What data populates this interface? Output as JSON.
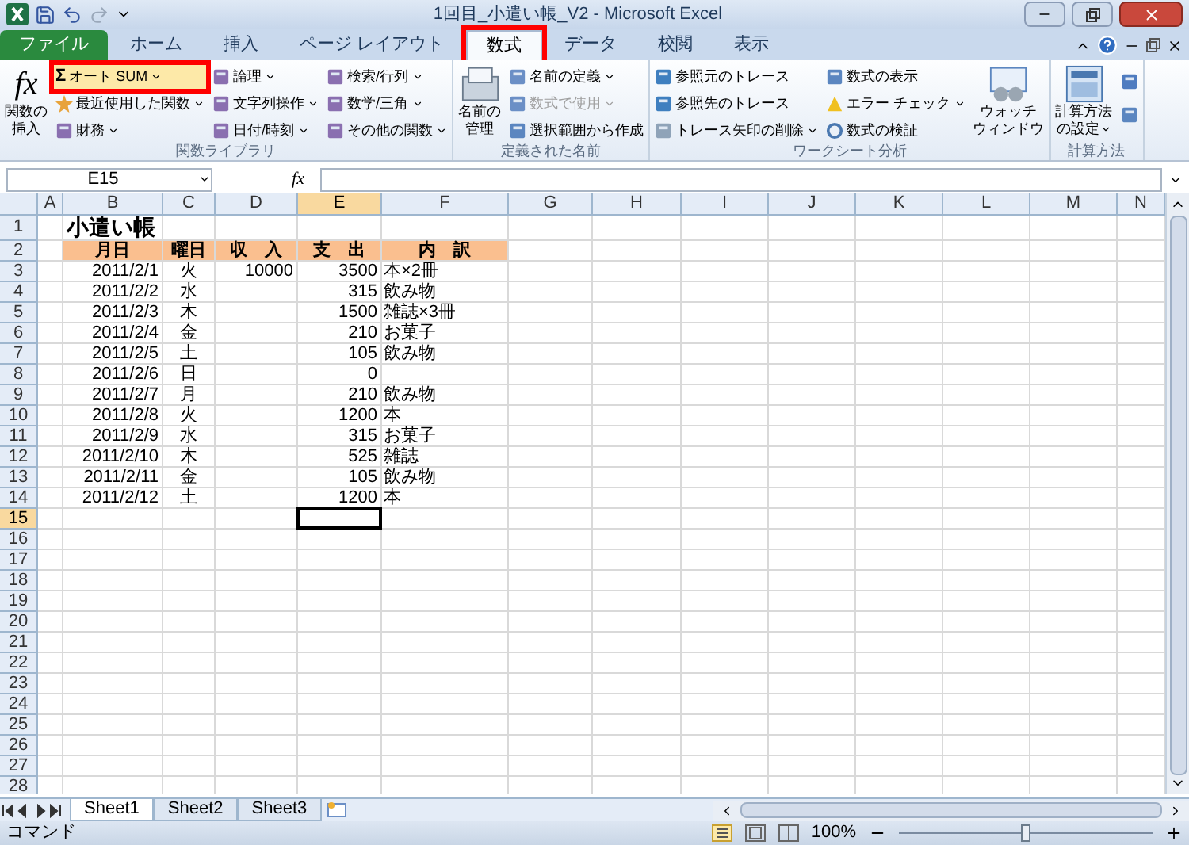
{
  "window": {
    "title": "1回目_小遣い帳_V2 - Microsoft Excel"
  },
  "tabs": [
    {
      "label": "ファイル",
      "kind": "file",
      "selected": false,
      "highlighted": false
    },
    {
      "label": "ホーム",
      "kind": "tab",
      "selected": false,
      "highlighted": false
    },
    {
      "label": "挿入",
      "kind": "tab",
      "selected": false,
      "highlighted": false
    },
    {
      "label": "ページ レイアウト",
      "kind": "tab",
      "selected": false,
      "highlighted": false
    },
    {
      "label": "数式",
      "kind": "tab",
      "selected": true,
      "highlighted": true
    },
    {
      "label": "データ",
      "kind": "tab",
      "selected": false,
      "highlighted": false
    },
    {
      "label": "校閲",
      "kind": "tab",
      "selected": false,
      "highlighted": false
    },
    {
      "label": "表示",
      "kind": "tab",
      "selected": false,
      "highlighted": false
    }
  ],
  "ribbon": [
    {
      "label": "関数ライブラリ",
      "items": [
        {
          "kind": "large",
          "glyph": "fx",
          "lines": [
            "関数の",
            "挿入"
          ],
          "dropdown": false
        },
        {
          "kind": "column",
          "items": [
            {
              "label": "オート SUM",
              "glyph": "Σ",
              "dropdown": true,
              "disabled": false,
              "highlighted": true
            },
            {
              "label": "最近使用した関数",
              "dropdown": true,
              "disabled": false,
              "highlighted": false
            },
            {
              "label": "財務",
              "dropdown": true,
              "disabled": false,
              "highlighted": false
            }
          ]
        },
        {
          "kind": "column",
          "items": [
            {
              "label": "論理",
              "dropdown": true,
              "disabled": false,
              "highlighted": false
            },
            {
              "label": "文字列操作",
              "dropdown": true,
              "disabled": false,
              "highlighted": false
            },
            {
              "label": "日付/時刻",
              "dropdown": true,
              "disabled": false,
              "highlighted": false
            }
          ]
        },
        {
          "kind": "column",
          "items": [
            {
              "label": "検索/行列",
              "dropdown": true,
              "disabled": false,
              "highlighted": false
            },
            {
              "label": "数学/三角",
              "dropdown": true,
              "disabled": false,
              "highlighted": false
            },
            {
              "label": "その他の関数",
              "dropdown": true,
              "disabled": false,
              "highlighted": false
            }
          ]
        }
      ]
    },
    {
      "label": "定義された名前",
      "items": [
        {
          "kind": "large",
          "lines": [
            "名前の",
            "管理"
          ],
          "dropdown": false
        },
        {
          "kind": "column",
          "items": [
            {
              "label": "名前の定義",
              "dropdown": true,
              "disabled": false,
              "highlighted": false
            },
            {
              "label": "数式で使用",
              "dropdown": true,
              "disabled": true,
              "highlighted": false
            },
            {
              "label": "選択範囲から作成",
              "dropdown": false,
              "disabled": false,
              "highlighted": false
            }
          ]
        }
      ]
    },
    {
      "label": "ワークシート分析",
      "items": [
        {
          "kind": "column",
          "items": [
            {
              "label": "参照元のトレース",
              "dropdown": false,
              "disabled": false,
              "highlighted": false
            },
            {
              "label": "参照先のトレース",
              "dropdown": false,
              "disabled": false,
              "highlighted": false
            },
            {
              "label": "トレース矢印の削除",
              "dropdown": true,
              "disabled": false,
              "highlighted": false
            }
          ]
        },
        {
          "kind": "column",
          "items": [
            {
              "label": "数式の表示",
              "dropdown": false,
              "disabled": false,
              "highlighted": false
            },
            {
              "label": "エラー チェック",
              "dropdown": true,
              "disabled": false,
              "highlighted": false
            },
            {
              "label": "数式の検証",
              "dropdown": false,
              "disabled": false,
              "highlighted": false
            }
          ]
        },
        {
          "kind": "large",
          "lines": [
            "ウォッチ",
            "ウィンドウ"
          ],
          "dropdown": false
        }
      ]
    },
    {
      "label": "計算方法",
      "items": [
        {
          "kind": "large",
          "lines": [
            "計算方法",
            "の設定"
          ],
          "dropdown": true
        },
        {
          "kind": "icons"
        }
      ]
    }
  ],
  "formula_bar": {
    "name_box": "E15",
    "function_button": "fx"
  },
  "columns": [
    {
      "label": "A",
      "selected": false
    },
    {
      "label": "B",
      "selected": false
    },
    {
      "label": "C",
      "selected": false
    },
    {
      "label": "D",
      "selected": false
    },
    {
      "label": "E",
      "selected": true
    },
    {
      "label": "F",
      "selected": false
    },
    {
      "label": "G",
      "selected": false
    },
    {
      "label": "H",
      "selected": false
    },
    {
      "label": "I",
      "selected": false
    },
    {
      "label": "J",
      "selected": false
    },
    {
      "label": "K",
      "selected": false
    },
    {
      "label": "L",
      "selected": false
    },
    {
      "label": "M",
      "selected": false
    },
    {
      "label": "N",
      "selected": false
    }
  ],
  "rows": [
    {
      "number": "1",
      "selected": false,
      "kind": "title",
      "title": "小遣い帳"
    },
    {
      "number": "2",
      "selected": false,
      "kind": "header",
      "cells": [
        "月日",
        "曜日",
        "収　入",
        "支　出",
        "内　訳"
      ]
    },
    {
      "number": "3",
      "selected": false,
      "kind": "data",
      "date": "2011/2/1",
      "weekday": "火",
      "income": "10000",
      "expense": "3500",
      "detail": "本×2冊"
    },
    {
      "number": "4",
      "selected": false,
      "kind": "data",
      "date": "2011/2/2",
      "weekday": "水",
      "expense": "315",
      "detail": "飲み物"
    },
    {
      "number": "5",
      "selected": false,
      "kind": "data",
      "date": "2011/2/3",
      "weekday": "木",
      "expense": "1500",
      "detail": "雑誌×3冊"
    },
    {
      "number": "6",
      "selected": false,
      "kind": "data",
      "date": "2011/2/4",
      "weekday": "金",
      "expense": "210",
      "detail": "お菓子"
    },
    {
      "number": "7",
      "selected": false,
      "kind": "data",
      "date": "2011/2/5",
      "weekday": "土",
      "expense": "105",
      "detail": "飲み物"
    },
    {
      "number": "8",
      "selected": false,
      "kind": "data",
      "date": "2011/2/6",
      "weekday": "日",
      "expense": "0"
    },
    {
      "number": "9",
      "selected": false,
      "kind": "data",
      "date": "2011/2/7",
      "weekday": "月",
      "expense": "210",
      "detail": "飲み物"
    },
    {
      "number": "10",
      "selected": false,
      "kind": "data",
      "date": "2011/2/8",
      "weekday": "火",
      "expense": "1200",
      "detail": "本"
    },
    {
      "number": "11",
      "selected": false,
      "kind": "data",
      "date": "2011/2/9",
      "weekday": "水",
      "expense": "315",
      "detail": "お菓子"
    },
    {
      "number": "12",
      "selected": false,
      "kind": "data",
      "date": "2011/2/10",
      "weekday": "木",
      "expense": "525",
      "detail": "雑誌"
    },
    {
      "number": "13",
      "selected": false,
      "kind": "data",
      "date": "2011/2/11",
      "weekday": "金",
      "expense": "105",
      "detail": "飲み物"
    },
    {
      "number": "14",
      "selected": false,
      "kind": "data",
      "date": "2011/2/12",
      "weekday": "土",
      "expense": "1200",
      "detail": "本"
    },
    {
      "number": "15",
      "selected": true,
      "kind": "empty"
    },
    {
      "number": "16",
      "selected": false,
      "kind": "empty"
    },
    {
      "number": "17",
      "selected": false,
      "kind": "empty"
    },
    {
      "number": "18",
      "selected": false,
      "kind": "empty"
    },
    {
      "number": "19",
      "selected": false,
      "kind": "empty"
    },
    {
      "number": "20",
      "selected": false,
      "kind": "empty"
    },
    {
      "number": "21",
      "selected": false,
      "kind": "empty"
    },
    {
      "number": "22",
      "selected": false,
      "kind": "empty"
    },
    {
      "number": "23",
      "selected": false,
      "kind": "empty"
    },
    {
      "number": "24",
      "selected": false,
      "kind": "empty"
    },
    {
      "number": "25",
      "selected": false,
      "kind": "empty"
    },
    {
      "number": "26",
      "selected": false,
      "kind": "empty"
    },
    {
      "number": "27",
      "selected": false,
      "kind": "empty"
    },
    {
      "number": "28",
      "selected": false,
      "kind": "empty"
    }
  ],
  "sheet_tabs": [
    {
      "label": "Sheet1",
      "selected": true
    },
    {
      "label": "Sheet2",
      "selected": false
    },
    {
      "label": "Sheet3",
      "selected": false
    }
  ],
  "status_bar": {
    "mode": "コマンド",
    "zoom": "100%",
    "zoom_slider": {
      "level": 0.5
    }
  }
}
